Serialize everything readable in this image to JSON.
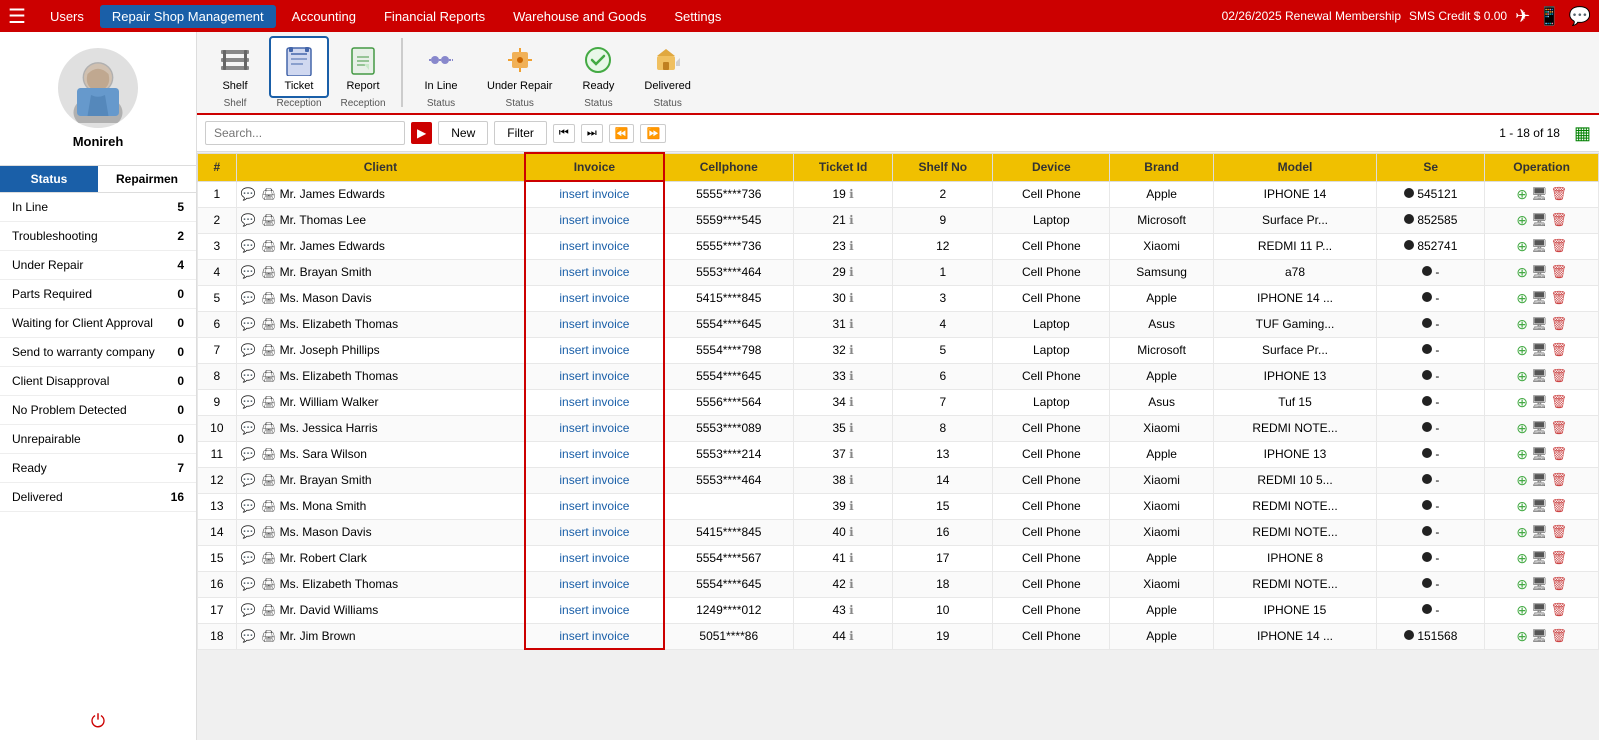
{
  "topNav": {
    "items": [
      "Users",
      "Repair Shop Management",
      "Accounting",
      "Financial Reports",
      "Warehouse and Goods",
      "Settings"
    ],
    "activeItem": "Repair Shop Management",
    "rightInfo": "02/26/2025 Renewal Membership",
    "smsCredit": "SMS Credit $ 0.00"
  },
  "sidebar": {
    "username": "Monireh",
    "tabs": [
      "Status",
      "Repairmen"
    ],
    "activeTab": "Status",
    "statusItems": [
      {
        "label": "In Line",
        "count": 5
      },
      {
        "label": "Troubleshooting",
        "count": 2
      },
      {
        "label": "Under Repair",
        "count": 4
      },
      {
        "label": "Parts Required",
        "count": 0
      },
      {
        "label": "Waiting for Client Approval",
        "count": 0
      },
      {
        "label": "Send to warranty company",
        "count": 0
      },
      {
        "label": "Client Disapproval",
        "count": 0
      },
      {
        "label": "No Problem Detected",
        "count": 0
      },
      {
        "label": "Unrepairable",
        "count": 0
      },
      {
        "label": "Ready",
        "count": 7
      },
      {
        "label": "Delivered",
        "count": 16
      }
    ]
  },
  "toolbar": {
    "buttons": [
      {
        "label": "Shelf",
        "icon": "shelf",
        "group": "Shelf"
      },
      {
        "label": "Ticket",
        "icon": "ticket",
        "group": "Reception",
        "active": true
      },
      {
        "label": "Report",
        "icon": "report",
        "group": "Reception"
      },
      {
        "label": "In Line",
        "icon": "inline",
        "group": "Status"
      },
      {
        "label": "Under Repair",
        "icon": "underrepair",
        "group": "Status"
      },
      {
        "label": "Ready",
        "icon": "ready",
        "group": "Status"
      },
      {
        "label": "Delivered",
        "icon": "delivered",
        "group": "Status"
      }
    ]
  },
  "actionBar": {
    "searchPlaceholder": "Search...",
    "newLabel": "New",
    "filterLabel": "Filter",
    "pageInfo": "1 - 18 of 18"
  },
  "table": {
    "headers": [
      "#",
      "Client",
      "Invoice",
      "Cellphone",
      "Ticket Id",
      "Shelf No",
      "Device",
      "Brand",
      "Model",
      "Se",
      "Operation"
    ],
    "rows": [
      {
        "num": 1,
        "client": "Mr. James Edwards",
        "invoice": "insert invoice",
        "cellphone": "5555****736",
        "ticketId": 19,
        "shelfNo": 2,
        "device": "Cell Phone",
        "brand": "Apple",
        "model": "IPHONE 14",
        "se": "545121",
        "hasDot": true
      },
      {
        "num": 2,
        "client": "Mr. Thomas Lee",
        "invoice": "insert invoice",
        "cellphone": "5559****545",
        "ticketId": 21,
        "shelfNo": 9,
        "device": "Laptop",
        "brand": "Microsoft",
        "model": "Surface Pr...",
        "se": "852585",
        "hasDot": true
      },
      {
        "num": 3,
        "client": "Mr. James Edwards",
        "invoice": "insert invoice",
        "cellphone": "5555****736",
        "ticketId": 23,
        "shelfNo": 12,
        "device": "Cell Phone",
        "brand": "Xiaomi",
        "model": "REDMI 11 P...",
        "se": "852741",
        "hasDot": true
      },
      {
        "num": 4,
        "client": "Mr. Brayan Smith",
        "invoice": "insert invoice",
        "cellphone": "5553****464",
        "ticketId": 29,
        "shelfNo": 1,
        "device": "Cell Phone",
        "brand": "Samsung",
        "model": "a78",
        "se": "-",
        "hasDot": true
      },
      {
        "num": 5,
        "client": "Ms. Mason Davis",
        "invoice": "insert invoice",
        "cellphone": "5415****845",
        "ticketId": 30,
        "shelfNo": 3,
        "device": "Cell Phone",
        "brand": "Apple",
        "model": "IPHONE 14 ...",
        "se": "-",
        "hasDot": true
      },
      {
        "num": 6,
        "client": "Ms. Elizabeth Thomas",
        "invoice": "insert invoice",
        "cellphone": "5554****645",
        "ticketId": 31,
        "shelfNo": 4,
        "device": "Laptop",
        "brand": "Asus",
        "model": "TUF Gaming...",
        "se": "-",
        "hasDot": true
      },
      {
        "num": 7,
        "client": "Mr. Joseph Phillips",
        "invoice": "insert invoice",
        "cellphone": "5554****798",
        "ticketId": 32,
        "shelfNo": 5,
        "device": "Laptop",
        "brand": "Microsoft",
        "model": "Surface Pr...",
        "se": "-",
        "hasDot": true
      },
      {
        "num": 8,
        "client": "Ms. Elizabeth Thomas",
        "invoice": "insert invoice",
        "cellphone": "5554****645",
        "ticketId": 33,
        "shelfNo": 6,
        "device": "Cell Phone",
        "brand": "Apple",
        "model": "IPHONE 13",
        "se": "-",
        "hasDot": true
      },
      {
        "num": 9,
        "client": "Mr. William Walker",
        "invoice": "insert invoice",
        "cellphone": "5556****564",
        "ticketId": 34,
        "shelfNo": 7,
        "device": "Laptop",
        "brand": "Asus",
        "model": "Tuf 15",
        "se": "-",
        "hasDot": true
      },
      {
        "num": 10,
        "client": "Ms. Jessica Harris",
        "invoice": "insert invoice",
        "cellphone": "5553****089",
        "ticketId": 35,
        "shelfNo": 8,
        "device": "Cell Phone",
        "brand": "Xiaomi",
        "model": "REDMI NOTE...",
        "se": "-",
        "hasDot": true
      },
      {
        "num": 11,
        "client": "Ms. Sara Wilson",
        "invoice": "insert invoice",
        "cellphone": "5553****214",
        "ticketId": 37,
        "shelfNo": 13,
        "device": "Cell Phone",
        "brand": "Apple",
        "model": "IPHONE 13",
        "se": "-",
        "hasDot": true
      },
      {
        "num": 12,
        "client": "Mr. Brayan Smith",
        "invoice": "insert invoice",
        "cellphone": "5553****464",
        "ticketId": 38,
        "shelfNo": 14,
        "device": "Cell Phone",
        "brand": "Xiaomi",
        "model": "REDMI 10 5...",
        "se": "-",
        "hasDot": true
      },
      {
        "num": 13,
        "client": "Ms. Mona Smith",
        "invoice": "insert invoice",
        "cellphone": "",
        "ticketId": 39,
        "shelfNo": 15,
        "device": "Cell Phone",
        "brand": "Xiaomi",
        "model": "REDMI NOTE...",
        "se": "-",
        "hasDot": true
      },
      {
        "num": 14,
        "client": "Ms. Mason Davis",
        "invoice": "insert invoice",
        "cellphone": "5415****845",
        "ticketId": 40,
        "shelfNo": 16,
        "device": "Cell Phone",
        "brand": "Xiaomi",
        "model": "REDMI NOTE...",
        "se": "-",
        "hasDot": true
      },
      {
        "num": 15,
        "client": "Mr. Robert Clark",
        "invoice": "insert invoice",
        "cellphone": "5554****567",
        "ticketId": 41,
        "shelfNo": 17,
        "device": "Cell Phone",
        "brand": "Apple",
        "model": "IPHONE 8",
        "se": "-",
        "hasDot": true
      },
      {
        "num": 16,
        "client": "Ms. Elizabeth Thomas",
        "invoice": "insert invoice",
        "cellphone": "5554****645",
        "ticketId": 42,
        "shelfNo": 18,
        "device": "Cell Phone",
        "brand": "Xiaomi",
        "model": "REDMI NOTE...",
        "se": "-",
        "hasDot": true
      },
      {
        "num": 17,
        "client": "Mr. David Williams",
        "invoice": "insert invoice",
        "cellphone": "1249****012",
        "ticketId": 43,
        "shelfNo": 10,
        "device": "Cell Phone",
        "brand": "Apple",
        "model": "IPHONE 15",
        "se": "-",
        "hasDot": true
      },
      {
        "num": 18,
        "client": "Mr. Jim Brown",
        "invoice": "insert invoice",
        "cellphone": "5051****86",
        "ticketId": 44,
        "shelfNo": 19,
        "device": "Cell Phone",
        "brand": "Apple",
        "model": "IPHONE 14 ...",
        "se": "151568",
        "hasDot": true
      }
    ]
  }
}
